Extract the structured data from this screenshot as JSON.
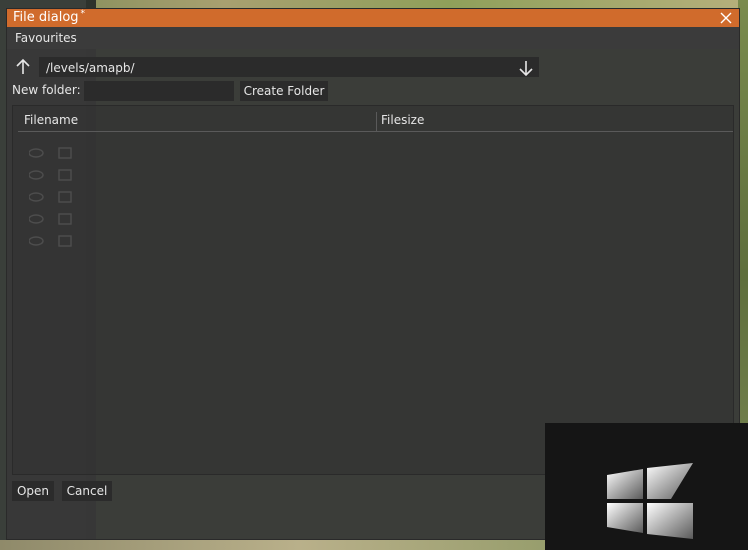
{
  "window": {
    "title": "File dialog",
    "modified_marker": "*"
  },
  "menu": {
    "favourites": "Favourites"
  },
  "path": {
    "value": "/levels/amapb/"
  },
  "new_folder": {
    "label": "New folder:",
    "value": "",
    "placeholder": "",
    "create_label": "Create Folder"
  },
  "table": {
    "columns": [
      "Filename",
      "Filesize"
    ],
    "rows": []
  },
  "actions": {
    "open_label": "Open",
    "cancel_label": "Cancel"
  },
  "colors": {
    "titlebar": "#d06b2c",
    "window_bg": "#383838",
    "field_bg": "#2b2b2b",
    "overlay_bg": "#151515"
  },
  "icons": {
    "close": "close-icon",
    "up": "arrow-up-icon",
    "dropdown": "arrow-down-icon",
    "os": "windows-logo-icon"
  }
}
